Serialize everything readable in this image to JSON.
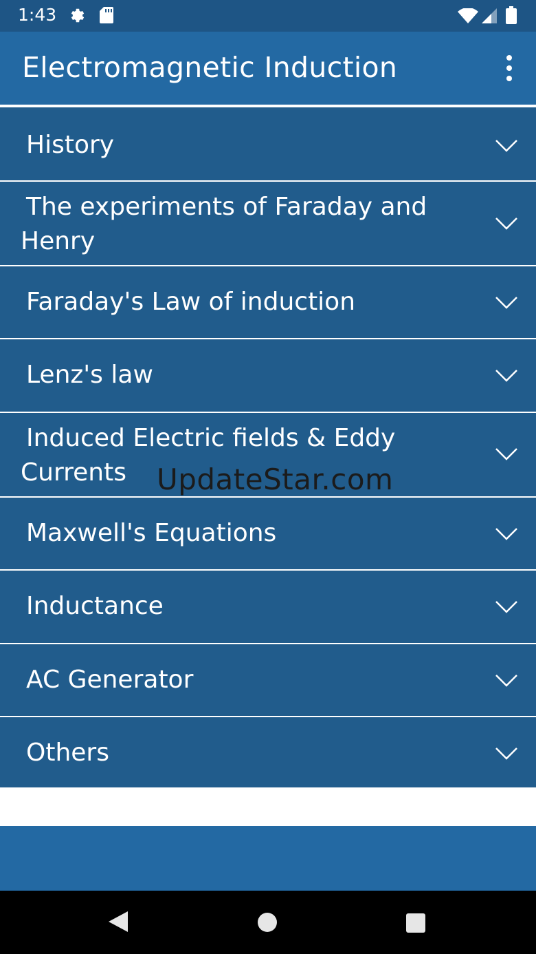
{
  "status_bar": {
    "time": "1:43",
    "icons": [
      "gear-icon",
      "sd-card-icon",
      "wifi-icon",
      "signal-icon",
      "battery-icon"
    ]
  },
  "app_bar": {
    "title": "Electromagnetic Induction",
    "menu_icon": "more-vert-icon"
  },
  "topics": [
    {
      "label": "History"
    },
    {
      "label": "The experiments of Faraday and Henry"
    },
    {
      "label": "Faraday's Law of induction"
    },
    {
      "label": "Lenz's law"
    },
    {
      "label": "Induced Electric fields & Eddy Currents"
    },
    {
      "label": "Maxwell's Equations"
    },
    {
      "label": "Inductance"
    },
    {
      "label": "AC Generator"
    },
    {
      "label": "Others"
    }
  ],
  "watermark": "UpdateStar.com",
  "nav_bar": {
    "back": "back-icon",
    "home": "home-icon",
    "recents": "recents-icon"
  },
  "colors": {
    "status_bar": "#1e5585",
    "app_bar": "#2369a3",
    "list_item": "#215c8c",
    "nav_bar": "#000000"
  }
}
